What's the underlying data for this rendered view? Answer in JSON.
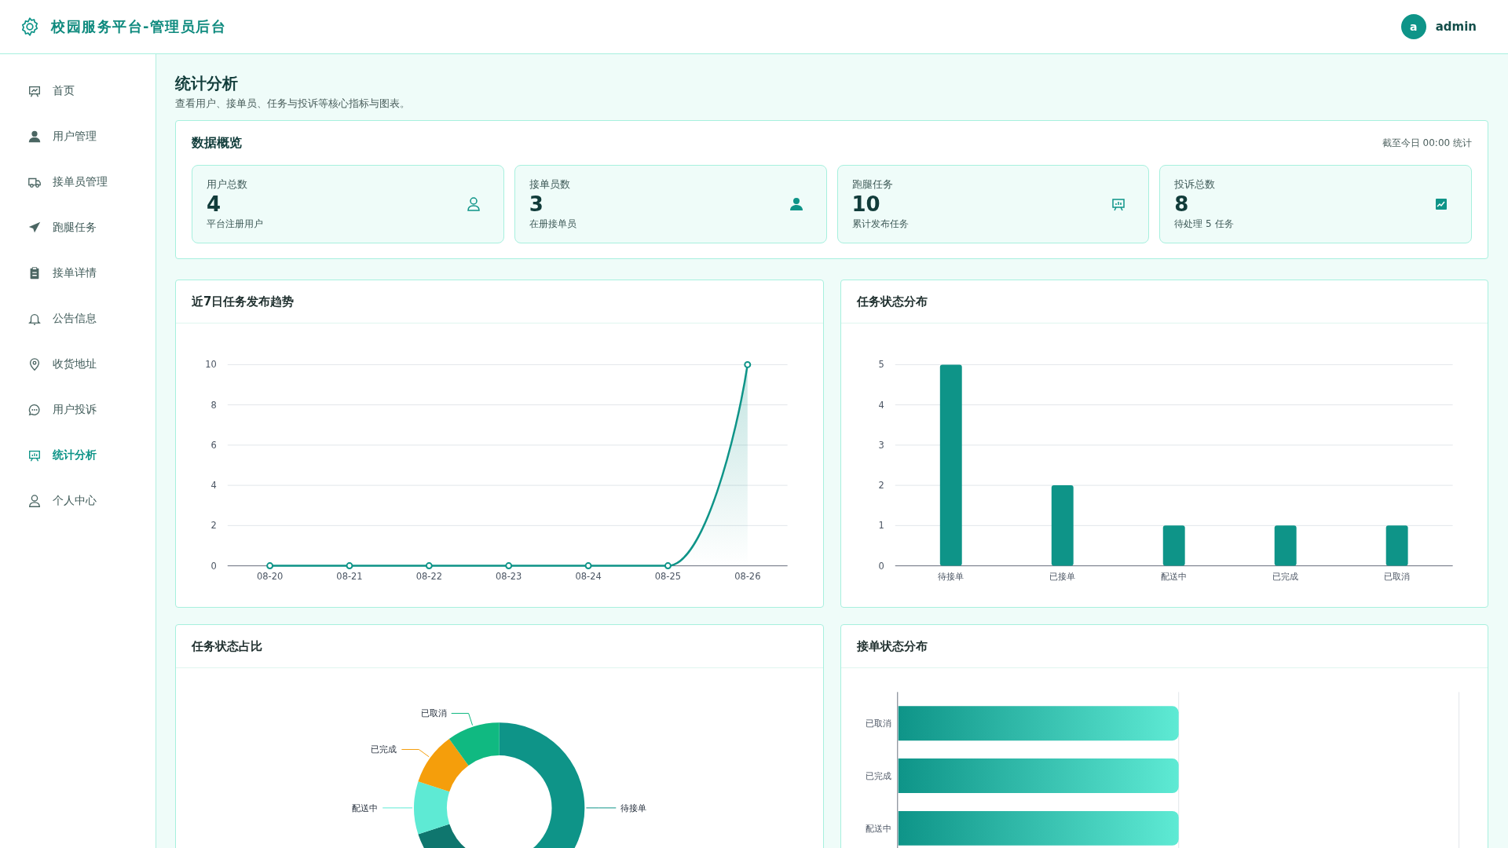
{
  "header": {
    "title": "校园服务平台-管理员后台",
    "avatar": "a",
    "user": "admin"
  },
  "sidebar": {
    "items": [
      {
        "label": "首页",
        "selected": false
      },
      {
        "label": "用户管理",
        "selected": false
      },
      {
        "label": "接单员管理",
        "selected": false
      },
      {
        "label": "跑腿任务",
        "selected": false
      },
      {
        "label": "接单详情",
        "selected": false
      },
      {
        "label": "公告信息",
        "selected": false
      },
      {
        "label": "收货地址",
        "selected": false
      },
      {
        "label": "用户投诉",
        "selected": false
      },
      {
        "label": "统计分析",
        "selected": true
      },
      {
        "label": "个人中心",
        "selected": false
      }
    ]
  },
  "page": {
    "title": "统计分析",
    "subtitle": "查看用户、接单员、任务与投诉等核心指标与图表。"
  },
  "overview": {
    "title": "数据概览",
    "note": "截至今日 00:00 统计",
    "stats": [
      {
        "label": "用户总数",
        "value": "4",
        "caption": "平台注册用户"
      },
      {
        "label": "接单员数",
        "value": "3",
        "caption": "在册接单员"
      },
      {
        "label": "跑腿任务",
        "value": "10",
        "caption": "累计发布任务"
      },
      {
        "label": "投诉总数",
        "value": "8",
        "caption": "待处理 5 任务"
      }
    ]
  },
  "trend_chart": {
    "title": "近7日任务发布趋势",
    "chart_data": {
      "type": "line",
      "grid": true,
      "categories": [
        "08-20",
        "08-21",
        "08-22",
        "08-23",
        "08-24",
        "08-25",
        "08-26"
      ],
      "ylim": [
        0,
        10
      ],
      "yticks": [
        0,
        2,
        4,
        6,
        8,
        10
      ],
      "series": [
        {
          "color": "#0e9488",
          "marker": true,
          "values": [
            0,
            0,
            0,
            0,
            0,
            0,
            10
          ]
        }
      ]
    }
  },
  "status_chart": {
    "title": "任务状态分布",
    "chart_data": {
      "type": "bar",
      "grid": true,
      "categories": [
        "待接单",
        "已接单",
        "配送中",
        "已完成",
        "已取消"
      ],
      "ylim": [
        0,
        5
      ],
      "yticks": [
        0,
        1,
        2,
        3,
        4,
        5
      ],
      "series": [
        {
          "color": "#0e9488",
          "values": [
            5,
            2,
            1,
            1,
            1
          ]
        }
      ]
    }
  },
  "ratio_chart": {
    "title": "任务状态占比",
    "chart_data": {
      "type": "donut",
      "categories": [
        "待接单",
        null,
        "配送中",
        "已完成",
        "已取消"
      ],
      "values": [
        50,
        20,
        10,
        10,
        10
      ]
    }
  },
  "order_chart": {
    "title": "接单状态分布",
    "bar_labels": [
      "已取消",
      "已完成",
      "配送中"
    ]
  }
}
